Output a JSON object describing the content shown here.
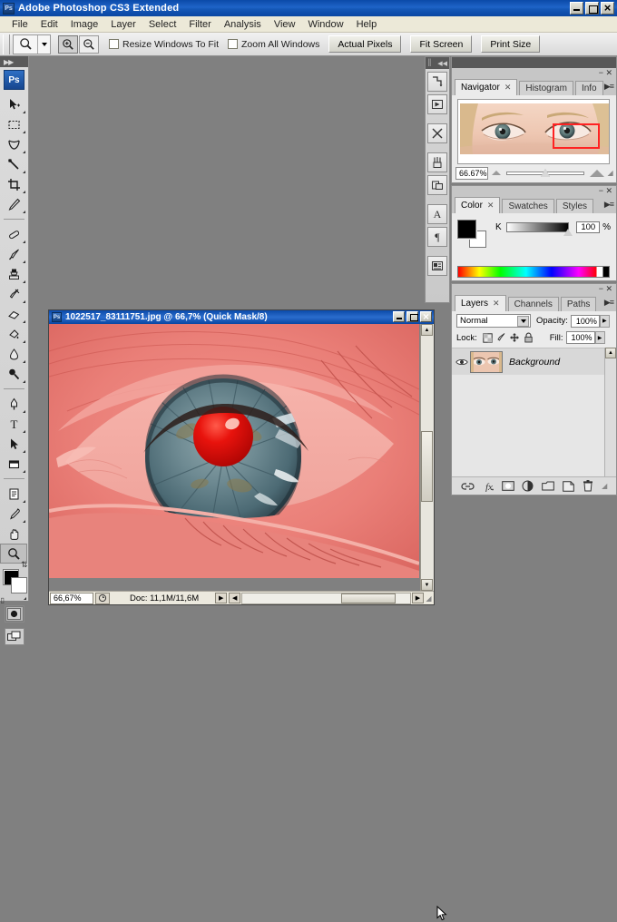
{
  "app": {
    "title": "Adobe Photoshop CS3 Extended",
    "logo_text": "Ps",
    "window_buttons": [
      "minimize-button",
      "maximize-button",
      "close-button"
    ]
  },
  "menubar": {
    "items": [
      "File",
      "Edit",
      "Image",
      "Layer",
      "Select",
      "Filter",
      "Analysis",
      "View",
      "Window",
      "Help"
    ]
  },
  "options_bar": {
    "active_tool": "zoom-tool",
    "zoom_in_label": "+",
    "zoom_out_label": "-",
    "checkboxes": [
      {
        "label": "Resize Windows To Fit",
        "checked": false
      },
      {
        "label": "Zoom All Windows",
        "checked": false
      }
    ],
    "buttons": [
      {
        "label": "Actual Pixels"
      },
      {
        "label": "Fit Screen"
      },
      {
        "label": "Print Size"
      }
    ]
  },
  "toolbox": {
    "logo": "Ps",
    "tools_upper": [
      {
        "name": "move-tool",
        "glyph": "move"
      },
      {
        "name": "marquee-tool",
        "glyph": "marquee"
      },
      {
        "name": "lasso-tool",
        "glyph": "lasso"
      },
      {
        "name": "magic-wand-tool",
        "glyph": "wand"
      },
      {
        "name": "crop-tool",
        "glyph": "crop"
      },
      {
        "name": "slice-tool",
        "glyph": "slice"
      }
    ],
    "tools_mid": [
      {
        "name": "healing-brush-tool",
        "glyph": "heal"
      },
      {
        "name": "brush-tool",
        "glyph": "brush"
      },
      {
        "name": "clone-stamp-tool",
        "glyph": "stamp"
      },
      {
        "name": "history-brush-tool",
        "glyph": "history"
      },
      {
        "name": "eraser-tool",
        "glyph": "eraser"
      },
      {
        "name": "gradient-tool",
        "glyph": "bucket"
      },
      {
        "name": "blur-tool",
        "glyph": "drop"
      },
      {
        "name": "dodge-tool",
        "glyph": "dodge"
      }
    ],
    "tools_lower": [
      {
        "name": "pen-tool",
        "glyph": "pen"
      },
      {
        "name": "type-tool",
        "glyph": "T"
      },
      {
        "name": "path-selection-tool",
        "glyph": "arrow"
      },
      {
        "name": "rectangle-tool",
        "glyph": "rect"
      }
    ],
    "tools_last": [
      {
        "name": "notes-tool",
        "glyph": "note"
      },
      {
        "name": "eyedropper-tool",
        "glyph": "dropper"
      },
      {
        "name": "hand-tool",
        "glyph": "hand"
      },
      {
        "name": "zoom-tool",
        "glyph": "zoom",
        "selected": true
      }
    ],
    "foreground_color": "#000000",
    "background_color": "#ffffff",
    "quick_mask_active": true,
    "screen_mode_label": "screen-mode"
  },
  "icon_dock": {
    "icons": [
      {
        "name": "history-panel-icon"
      },
      {
        "name": "actions-panel-icon"
      },
      {
        "name": "tool-presets-panel-icon"
      },
      {
        "name": "brushes-panel-icon"
      },
      {
        "name": "clone-source-panel-icon"
      },
      {
        "name": "character-panel-icon"
      },
      {
        "name": "paragraph-panel-icon"
      },
      {
        "name": "layer-comps-panel-icon"
      }
    ]
  },
  "navigator_panel": {
    "tabs": [
      {
        "label": "Navigator",
        "active": true,
        "closable": true
      },
      {
        "label": "Histogram",
        "active": false
      },
      {
        "label": "Info",
        "active": false
      }
    ],
    "zoom_value": "66.67%",
    "thumbnail_alt": "face-with-two-eyes-thumbnail",
    "view_box_color": "#ff2222"
  },
  "color_panel": {
    "tabs": [
      {
        "label": "Color",
        "active": true,
        "closable": true
      },
      {
        "label": "Swatches",
        "active": false
      },
      {
        "label": "Styles",
        "active": false
      }
    ],
    "channel_label": "K",
    "channel_value": "100",
    "percent_symbol": "%",
    "foreground_color": "#000000",
    "background_color": "#ffffff"
  },
  "layers_panel": {
    "tabs": [
      {
        "label": "Layers",
        "active": true,
        "closable": true
      },
      {
        "label": "Channels",
        "active": false
      },
      {
        "label": "Paths",
        "active": false
      }
    ],
    "blend_mode": "Normal",
    "opacity_label": "Opacity:",
    "opacity_value": "100%",
    "lock_label": "Lock:",
    "fill_label": "Fill:",
    "fill_value": "100%",
    "lock_icons": [
      "lock-transparency-icon",
      "lock-image-icon",
      "lock-position-icon",
      "lock-all-icon"
    ],
    "layers": [
      {
        "name": "Background",
        "visible": true,
        "locked": true
      }
    ],
    "bottom_buttons": [
      {
        "name": "link-layers-button",
        "label": "link"
      },
      {
        "name": "layer-style-button",
        "label": "fx"
      },
      {
        "name": "add-mask-button",
        "label": "mask"
      },
      {
        "name": "adjustment-layer-button",
        "label": "adjust"
      },
      {
        "name": "new-group-button",
        "label": "group"
      },
      {
        "name": "new-layer-button",
        "label": "new"
      },
      {
        "name": "delete-layer-button",
        "label": "trash"
      }
    ]
  },
  "document_window": {
    "title": "1022517_83111751.jpg @ 66,7% (Quick Mask/8)",
    "status_zoom": "66,67%",
    "status_doc": "Doc: 11,1M/11,6M",
    "window_buttons": [
      "minimize-button",
      "maximize-button",
      "close-button"
    ],
    "image_alt": "close-up-eye-with-red-quick-mask-overlay"
  }
}
